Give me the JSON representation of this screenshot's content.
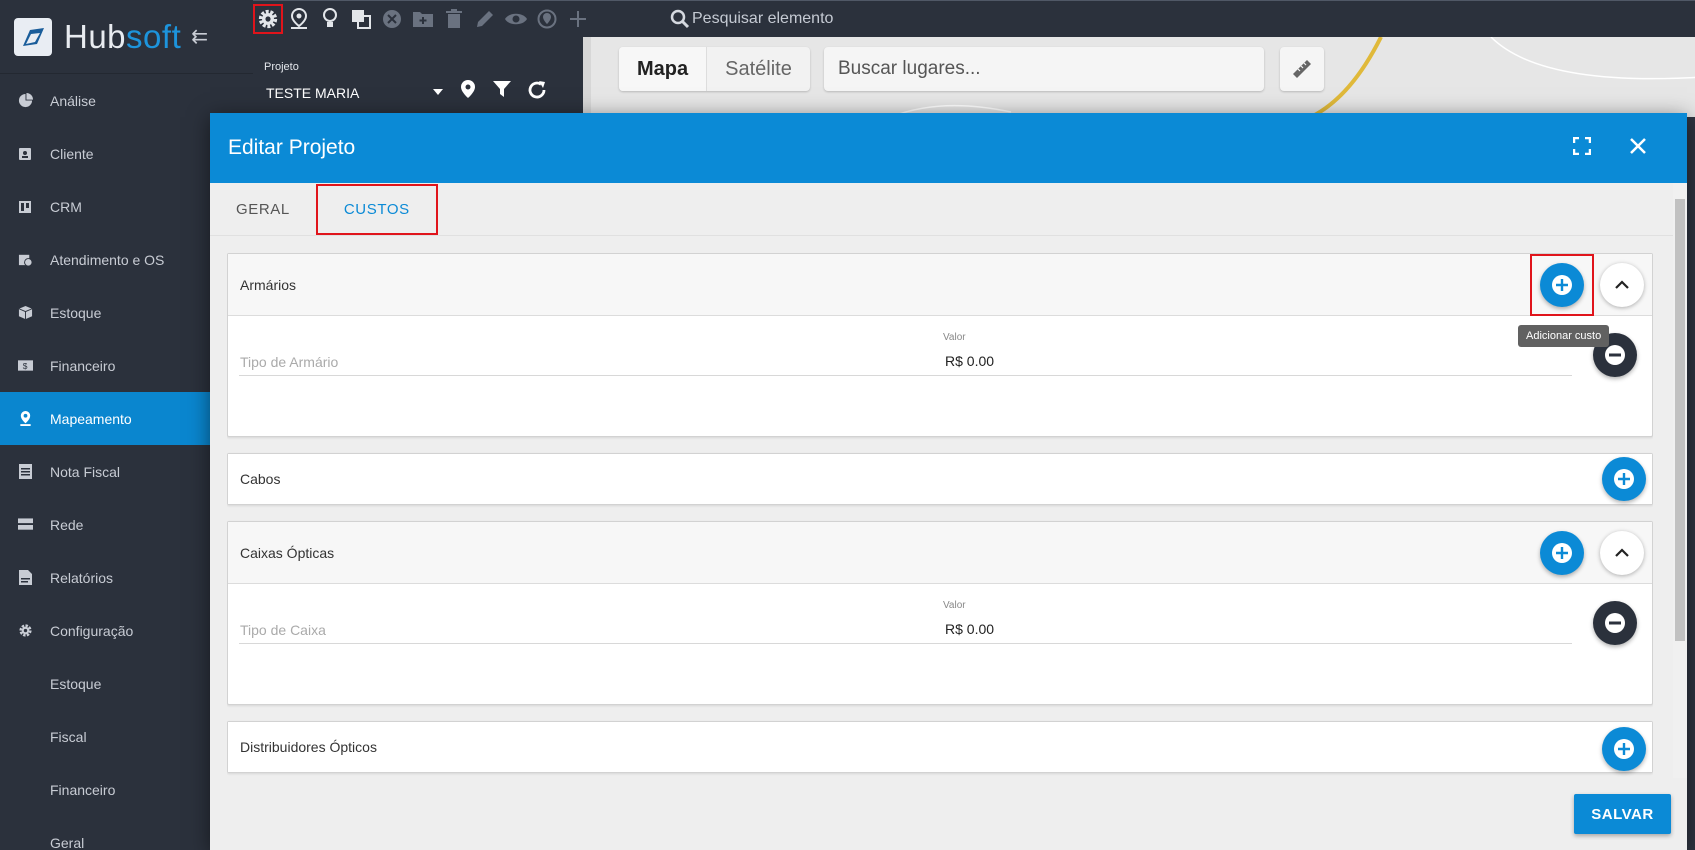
{
  "app": {
    "logo_hub": "Hub",
    "logo_soft": "soft"
  },
  "sidebar": {
    "items": [
      {
        "label": "Análise",
        "icon": "chart-pie-icon"
      },
      {
        "label": "Cliente",
        "icon": "id-card-icon"
      },
      {
        "label": "CRM",
        "icon": "board-icon"
      },
      {
        "label": "Atendimento e OS",
        "icon": "calendar-clock-icon"
      },
      {
        "label": "Estoque",
        "icon": "box-icon"
      },
      {
        "label": "Financeiro",
        "icon": "money-icon"
      },
      {
        "label": "Mapeamento",
        "icon": "map-pin-icon",
        "active": true
      },
      {
        "label": "Nota Fiscal",
        "icon": "document-icon"
      },
      {
        "label": "Rede",
        "icon": "server-icon"
      },
      {
        "label": "Relatórios",
        "icon": "report-icon"
      },
      {
        "label": "Configuração",
        "icon": "gear-icon"
      }
    ],
    "subitems": [
      "Estoque",
      "Fiscal",
      "Financeiro",
      "Geral"
    ]
  },
  "toolbar": {
    "search_placeholder": "Pesquisar elemento"
  },
  "project": {
    "label": "Projeto",
    "value": "TESTE MARIA"
  },
  "map": {
    "mode_map": "Mapa",
    "mode_satellite": "Satélite",
    "search_placeholder": "Buscar lugares..."
  },
  "modal": {
    "title": "Editar Projeto",
    "tabs": [
      "GERAL",
      "CUSTOS"
    ],
    "active_tab": "CUSTOS",
    "tooltip": "Adicionar custo",
    "save_label": "SALVAR",
    "sections": [
      {
        "title": "Armários",
        "field_placeholder": "Tipo de Armário",
        "value_label": "Valor",
        "value": "R$ 0.00"
      },
      {
        "title": "Cabos"
      },
      {
        "title": "Caixas Ópticas",
        "field_placeholder": "Tipo de Caixa",
        "value_label": "Valor",
        "value": "R$ 0.00"
      },
      {
        "title": "Distribuidores Ópticos"
      }
    ]
  },
  "colors": {
    "accent": "#0b8ad6",
    "sidebar_bg": "#2b313c",
    "highlight_box": "#e0141b"
  }
}
